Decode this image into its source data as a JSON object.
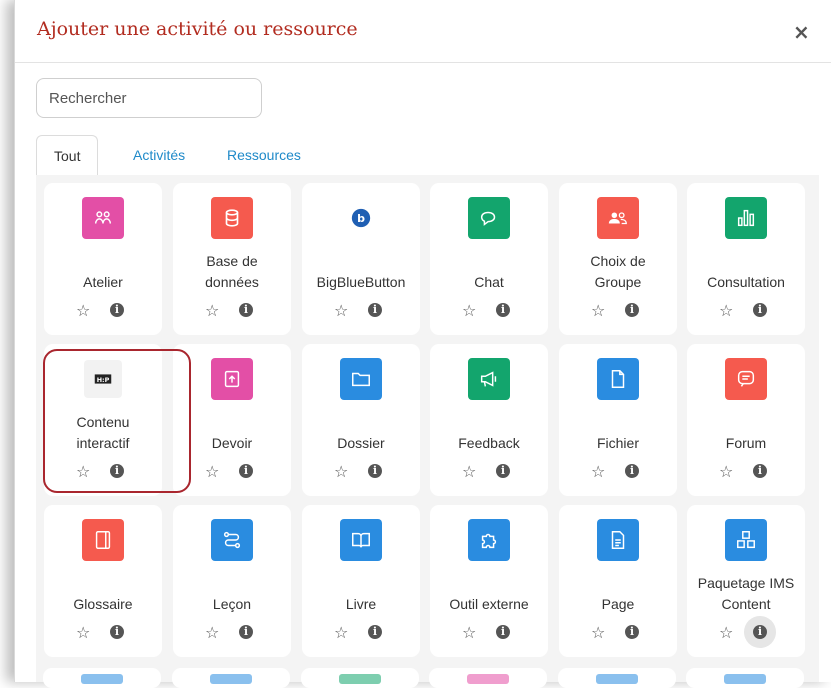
{
  "dialog": {
    "title": "Ajouter une activité ou ressource",
    "close_label": "×"
  },
  "search": {
    "placeholder": "Rechercher"
  },
  "tabs": [
    {
      "label": "Tout",
      "active": true
    },
    {
      "label": "Activités",
      "active": false
    },
    {
      "label": "Ressources",
      "active": false
    }
  ],
  "items": [
    {
      "label": "Atelier",
      "icon": "atelier-icon",
      "color": "#e34fa6"
    },
    {
      "label": "Base de données",
      "line1": "Base de",
      "line2": "données",
      "icon": "database-icon",
      "color": "#f55a4e"
    },
    {
      "label": "BigBlueButton",
      "icon": "bigbluebutton-icon",
      "color": "#ffffff"
    },
    {
      "label": "Chat",
      "icon": "chat-icon",
      "color": "#13a56d"
    },
    {
      "label": "Choix de Groupe",
      "line1": "Choix de",
      "line2": "Groupe",
      "icon": "group-choice-icon",
      "color": "#f55a4e"
    },
    {
      "label": "Consultation",
      "icon": "chart-bars-icon",
      "color": "#13a56d"
    },
    {
      "label": "Contenu interactif",
      "line1": "Contenu",
      "line2": "interactif",
      "icon": "h5p-icon",
      "icon_text": "H:P",
      "color": "#222222"
    },
    {
      "label": "Devoir",
      "icon": "assignment-upload-icon",
      "color": "#e34fa6"
    },
    {
      "label": "Dossier",
      "icon": "folder-icon",
      "color": "#2a8ce0"
    },
    {
      "label": "Feedback",
      "icon": "megaphone-icon",
      "color": "#13a56d"
    },
    {
      "label": "Fichier",
      "icon": "file-icon",
      "color": "#2a8ce0"
    },
    {
      "label": "Forum",
      "icon": "forum-icon",
      "color": "#f55a4e"
    },
    {
      "label": "Glossaire",
      "icon": "glossary-icon",
      "color": "#f55a4e"
    },
    {
      "label": "Leçon",
      "icon": "lesson-icon",
      "color": "#2a8ce0"
    },
    {
      "label": "Livre",
      "icon": "book-icon",
      "color": "#2a8ce0"
    },
    {
      "label": "Outil externe",
      "icon": "puzzle-icon",
      "color": "#2a8ce0"
    },
    {
      "label": "Page",
      "icon": "page-icon",
      "color": "#2a8ce0"
    },
    {
      "label": "Paquetage IMS Content",
      "line1": "Paquetage IMS",
      "line2": "Content",
      "icon": "ims-package-icon",
      "color": "#2a8ce0"
    }
  ],
  "highlighted_item": "Contenu interactif",
  "colors": {
    "title": "#b22c20",
    "link": "#1f8ac9",
    "annotation": "#a9262e"
  }
}
